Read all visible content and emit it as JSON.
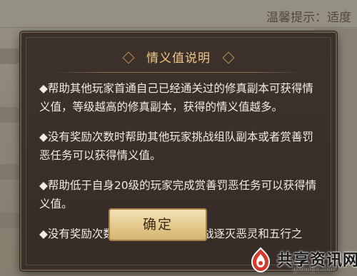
{
  "background": {
    "hint_label": "温馨提示：适度"
  },
  "dialog": {
    "title": "情义值说明",
    "paragraphs": [
      "◆帮助其他玩家首通自己已经通关过的修真副本可获得情义值，等级越高的修真副本，获得的情义值越多。",
      "◆没有奖励次数时帮助其他玩家挑战组队副本或者赏善罚恶任务可以获得情义值。",
      "◆帮助低于自身20级的玩家完成赏善罚恶任务可以获得情义值。",
      "◆没有奖励次数时帮助其他玩家挑战逐灭恶灵和五行之"
    ],
    "confirm_label": "确定"
  },
  "watermark": {
    "site_name": "共享资讯网",
    "site_url": "gxdaojia.com"
  },
  "colors": {
    "title": "#efc889",
    "body_text": "#f1ede6",
    "dialog_bg": "#3a2f2a",
    "button_bg": "#e3c98b"
  }
}
